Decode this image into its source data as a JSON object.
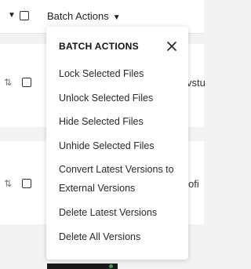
{
  "header": {
    "select_caret": "▼",
    "batch_label": "Batch Actions",
    "batch_caret": "▼"
  },
  "rows": [
    {
      "handle": "⇅",
      "name_fragment": "vstu"
    },
    {
      "handle": "⇅",
      "name_fragment": "ofi"
    }
  ],
  "batch_menu": {
    "title": "BATCH ACTIONS",
    "close_icon": "close-icon",
    "items": [
      {
        "label": "Lock Selected Files"
      },
      {
        "label": "Unlock Selected Files"
      },
      {
        "label": "Hide Selected Files"
      },
      {
        "label": "Unhide Selected Files"
      },
      {
        "label": "Convert Latest Versions to External Versions"
      },
      {
        "label": "Delete Latest Versions"
      },
      {
        "label": "Delete All Versions"
      }
    ]
  },
  "colors": {
    "page_background": "#f3f3f3",
    "surface": "#ffffff",
    "text": "#222222",
    "thumbnail": "#1a1a1a",
    "thumbnail_indicator": "#2ea44f"
  }
}
